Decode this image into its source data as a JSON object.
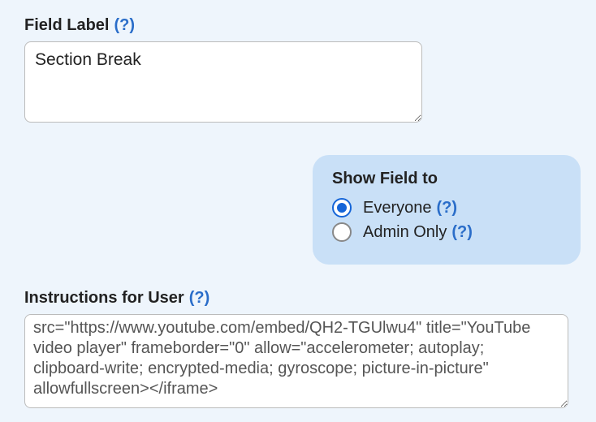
{
  "field_label": {
    "label": "Field Label",
    "help": "(?)",
    "value": "Section Break"
  },
  "show_field": {
    "title": "Show Field to",
    "options": [
      {
        "label": "Everyone",
        "help": "(?)",
        "checked": true
      },
      {
        "label": "Admin Only",
        "help": "(?)",
        "checked": false
      }
    ]
  },
  "instructions": {
    "label": "Instructions for User",
    "help": "(?)",
    "value": "src=\"https://www.youtube.com/embed/QH2-TGUlwu4\" title=\"YouTube video player\" frameborder=\"0\" allow=\"accelerometer; autoplay; clipboard-write; encrypted-media; gyroscope; picture-in-picture\" allowfullscreen></iframe>"
  }
}
